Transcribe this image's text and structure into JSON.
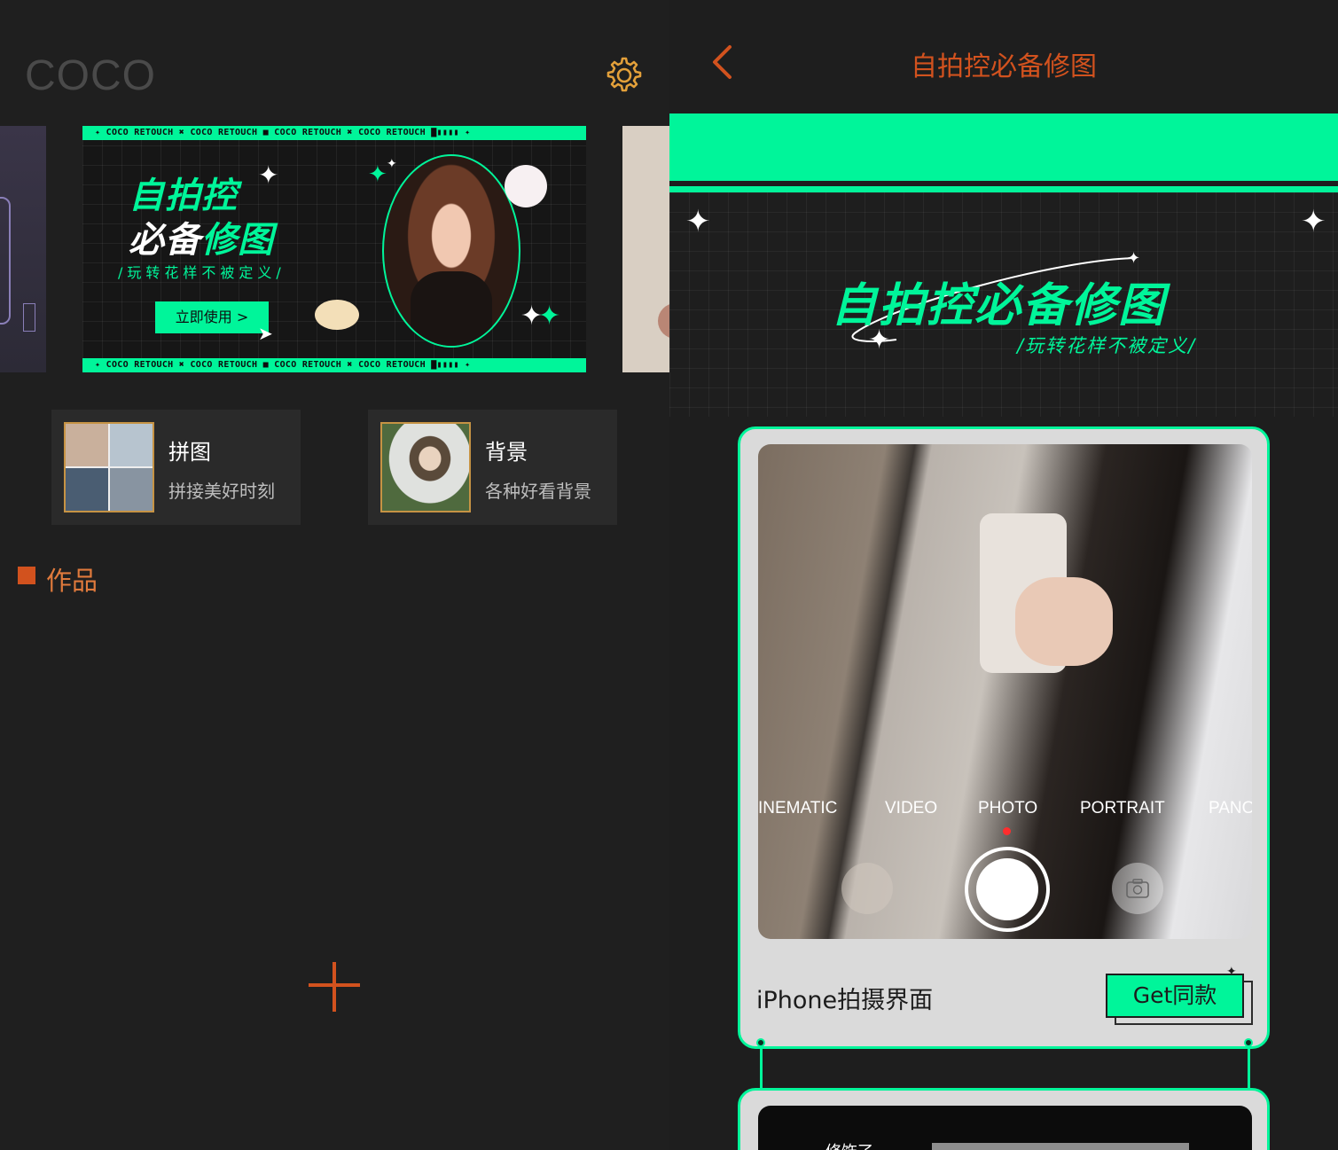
{
  "colors": {
    "accent_green": "#00f59a",
    "accent_orange": "#d2521e",
    "gold": "#c69344",
    "bg": "#1e1e1e"
  },
  "left": {
    "app_title": "COCO",
    "settings_icon": "gear-icon",
    "banner": {
      "strip_top": "✦ COCO RETOUCH ✖ COCO RETOUCH ■ COCO RETOUCH ✖ COCO RETOUCH ▇▮▮▮▮ ✦",
      "strip_bottom": "✦ COCO RETOUCH ✖ COCO RETOUCH ■ COCO RETOUCH ✖ COCO RETOUCH ▇▮▮▮▮ ✦",
      "title_line1": "自拍控",
      "title_line2_white": "必备",
      "title_line2_green": "修图",
      "subtitle": "/玩转花样不被定义/",
      "cta": "立即使用 >"
    },
    "features": [
      {
        "title": "拼图",
        "subtitle": "拼接美好时刻"
      },
      {
        "title": "背景",
        "subtitle": "各种好看背景"
      }
    ],
    "works_label": "作品",
    "add_icon": "plus-icon"
  },
  "right": {
    "back_icon": "chevron-left-icon",
    "title": "自拍控必备修图",
    "hero_title": "自拍控必备修图",
    "hero_subtitle": "/玩转花样不被定义/",
    "camera_modes": [
      "INEMATIC",
      "VIDEO",
      "PHOTO",
      "PORTRAIT",
      "PANO"
    ],
    "camera_active_mode": "PHOTO",
    "card_label": "iPhone拍摄界面",
    "get_button": "Get同款",
    "card2_text": "修饰了"
  }
}
